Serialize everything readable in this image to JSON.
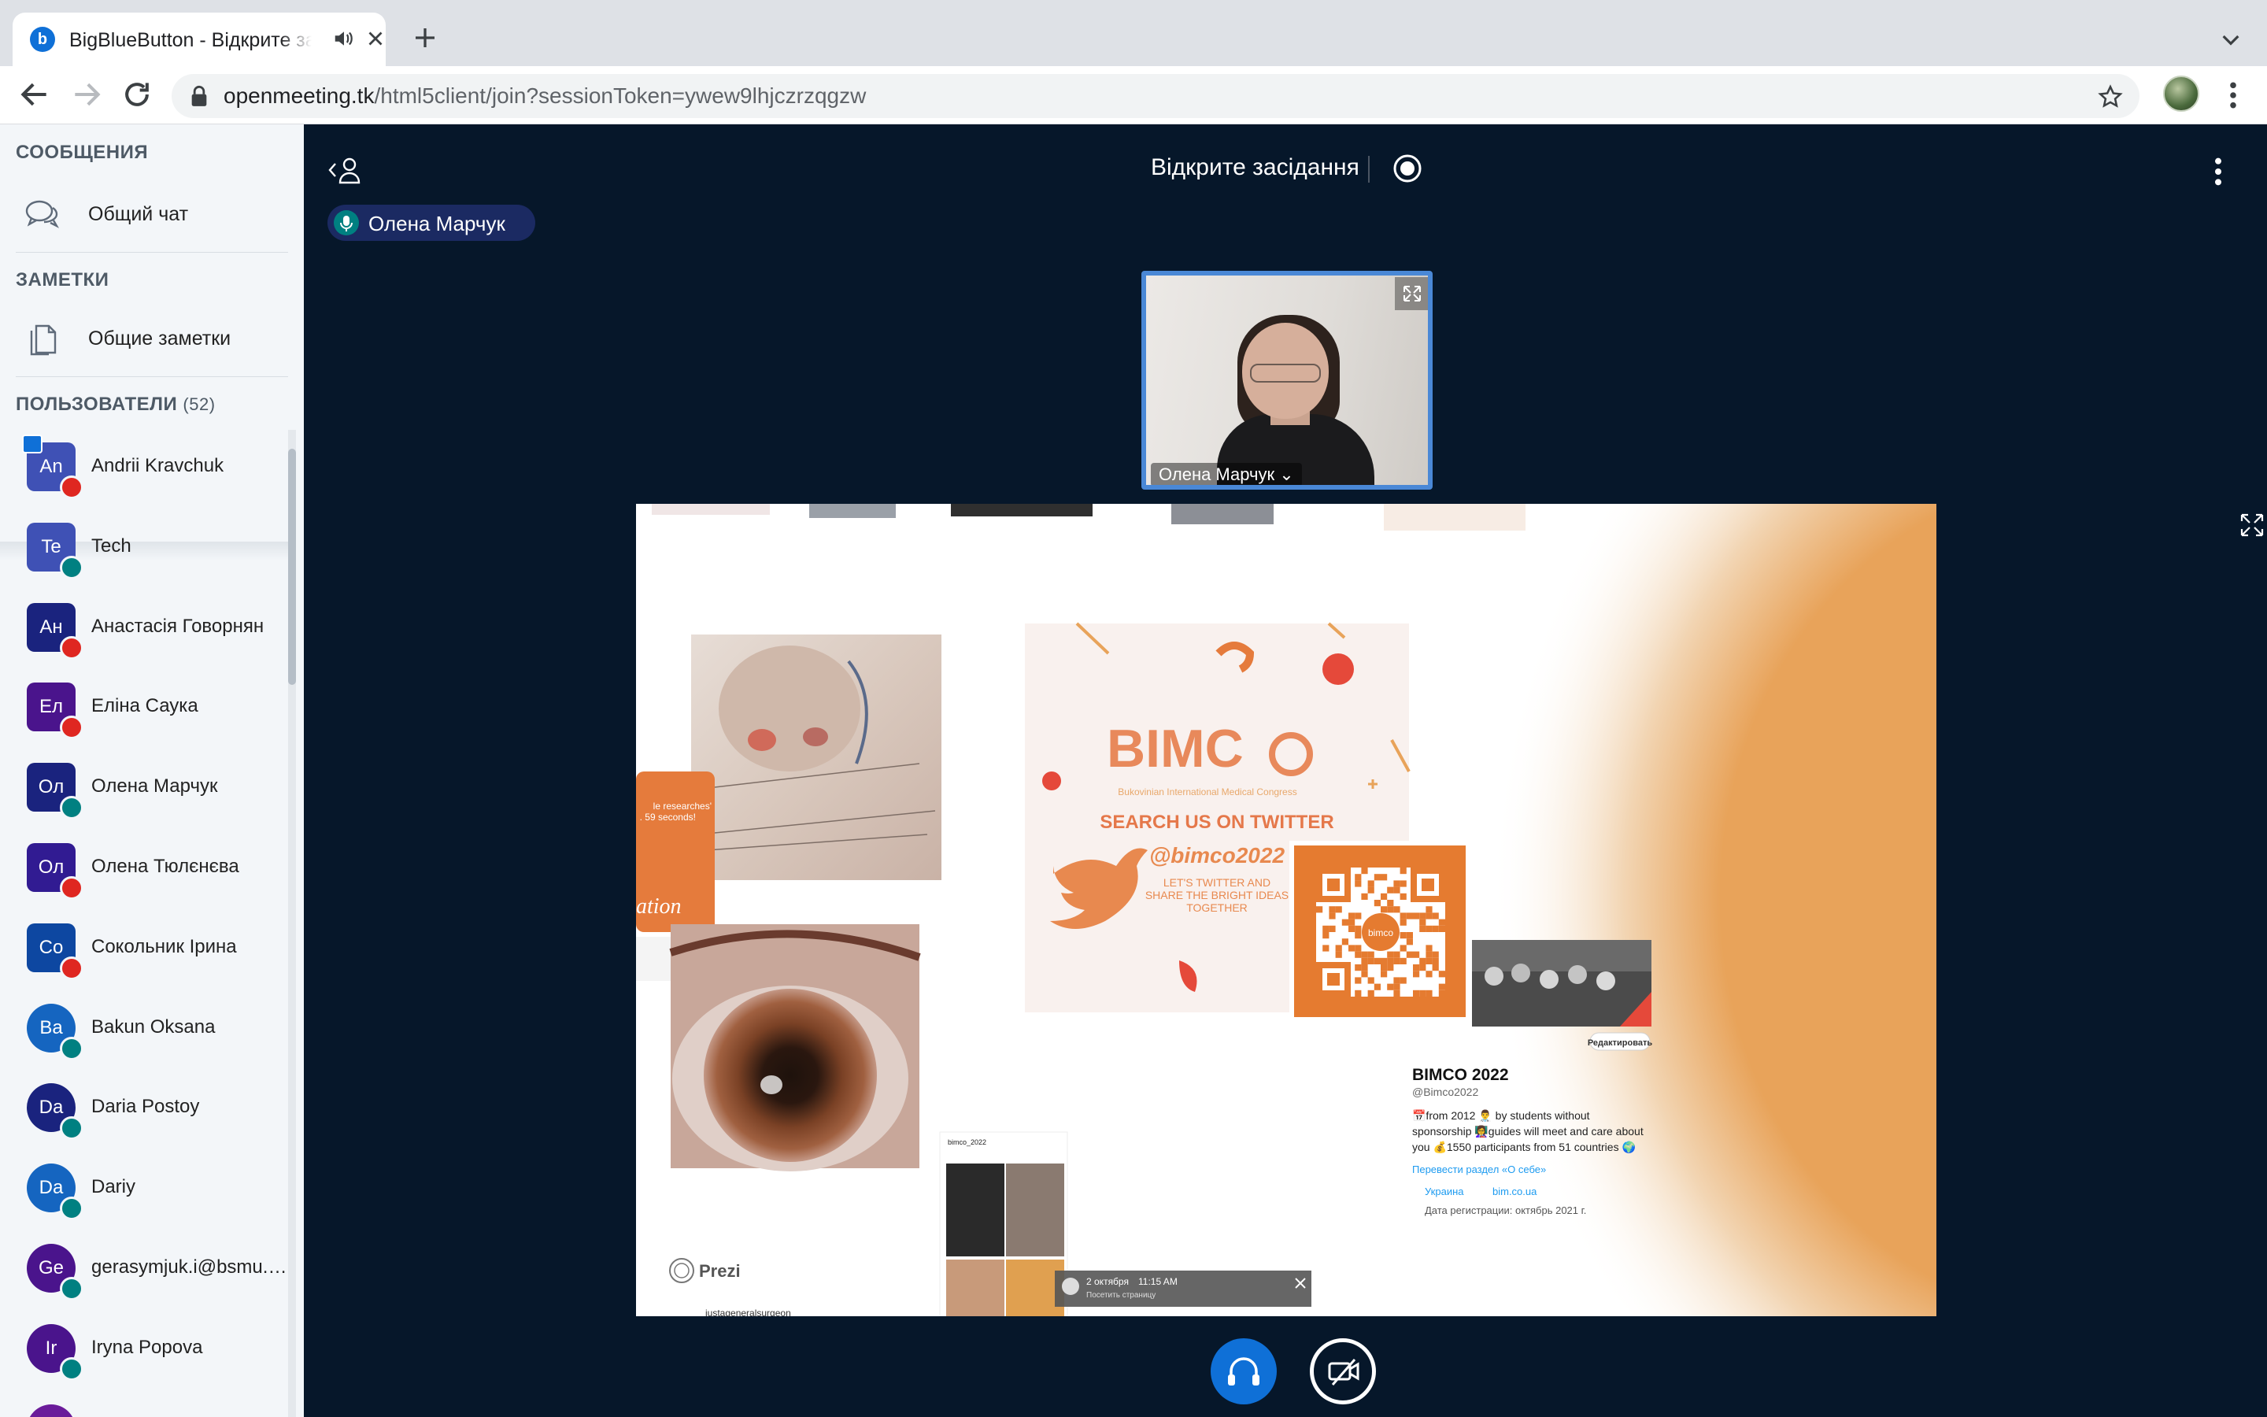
{
  "browser": {
    "tab_title": "BigBlueButton - Відкрите засідання",
    "favicon_letter": "b",
    "url_host": "openmeeting.tk",
    "url_path": "/html5client/join?sessionToken=ywew9lhjczrzqgzw"
  },
  "sidebar": {
    "messages_title": "СООБЩЕНИЯ",
    "public_chat": "Общий чат",
    "notes_title": "ЗАМЕТКИ",
    "shared_notes": "Общие заметки",
    "users_title": "ПОЛЬЗОВАТЕЛИ",
    "users_count": "(52)",
    "users": [
      {
        "initials": "An",
        "name": "Andrii Kravchuk",
        "color": "#3f51b5",
        "status": "muted",
        "presenter": true
      },
      {
        "initials": "Te",
        "name": "Tech",
        "color": "#3f51b5",
        "status": "listen",
        "presenter": false
      },
      {
        "initials": "Ан",
        "name": "Анастасія Говорнян",
        "color": "#1a237e",
        "status": "muted",
        "presenter": false
      },
      {
        "initials": "Ел",
        "name": "Еліна Саука",
        "color": "#4a148c",
        "status": "muted",
        "presenter": false
      },
      {
        "initials": "Ол",
        "name": "Олена Марчук",
        "color": "#1a237e",
        "status": "talk",
        "presenter": false
      },
      {
        "initials": "Ол",
        "name": "Олена Тюлєнєва",
        "color": "#311b92",
        "status": "muted",
        "presenter": false
      },
      {
        "initials": "Со",
        "name": "Сокольник Ірина",
        "color": "#0d47a1",
        "status": "muted",
        "presenter": false
      },
      {
        "initials": "Ba",
        "name": "Bakun Oksana",
        "color": "#1565c0",
        "status": "listen",
        "presenter": false
      },
      {
        "initials": "Da",
        "name": "Daria Postoy",
        "color": "#1a237e",
        "status": "listen",
        "presenter": false
      },
      {
        "initials": "Da",
        "name": "Dariy",
        "color": "#1565c0",
        "status": "listen",
        "presenter": false
      },
      {
        "initials": "Ge",
        "name": "gerasymjuk.i@bsmu.edu.ua",
        "color": "#4a148c",
        "status": "listen",
        "presenter": false
      },
      {
        "initials": "Ir",
        "name": "Iryna Popova",
        "color": "#4a148c",
        "status": "listen",
        "presenter": false
      },
      {
        "initials": "",
        "name": "",
        "color": "#6a1b9a",
        "status": "listen",
        "presenter": false
      }
    ]
  },
  "main": {
    "meeting_title": "Відкрите засідання",
    "talking_user": "Олена Марчук",
    "webcam_name": "Олена Марчук",
    "webcam_caret": "⌄"
  },
  "slide": {
    "bimco_logo": "BIMC",
    "bimco_sub": "Bukovinian International Medical Congress",
    "search_twitter": "SEARCH US ON TWITTER",
    "handle": "@bimco2022",
    "tagline_1": "LET'S TWITTER AND",
    "tagline_2": "SHARE THE BRIGHT IDEAS",
    "tagline_3": "TOGETHER",
    "qr_center": "bimco",
    "profile_name": "BIMCO 2022",
    "profile_handle": "@Bimco2022",
    "profile_bio_1": "📅from 2012 👨‍⚕️ by students without",
    "profile_bio_2": "sponsorship 👩‍🏫guides will meet and care about",
    "profile_bio_3": "you 💰1550 participants from 51 countries 🌍",
    "translate_link": "Перевести раздел «О себе»",
    "profile_location": "Украина",
    "profile_site": "bim.co.ua",
    "profile_joined": "Дата регистрации: октябрь 2021 г.",
    "edit_button": "Редактировать",
    "left_card_text_1": "le researches'",
    "left_card_text_2": ". 59 seconds!",
    "left_card_script": "ation",
    "insta_handle": "bimco_2022",
    "insta_handle_2": "justageneralsurgeon",
    "story_date": "2 октября",
    "story_time": "11:15 AM",
    "story_sub": "Посетить страницу",
    "prezi": "Prezi"
  }
}
